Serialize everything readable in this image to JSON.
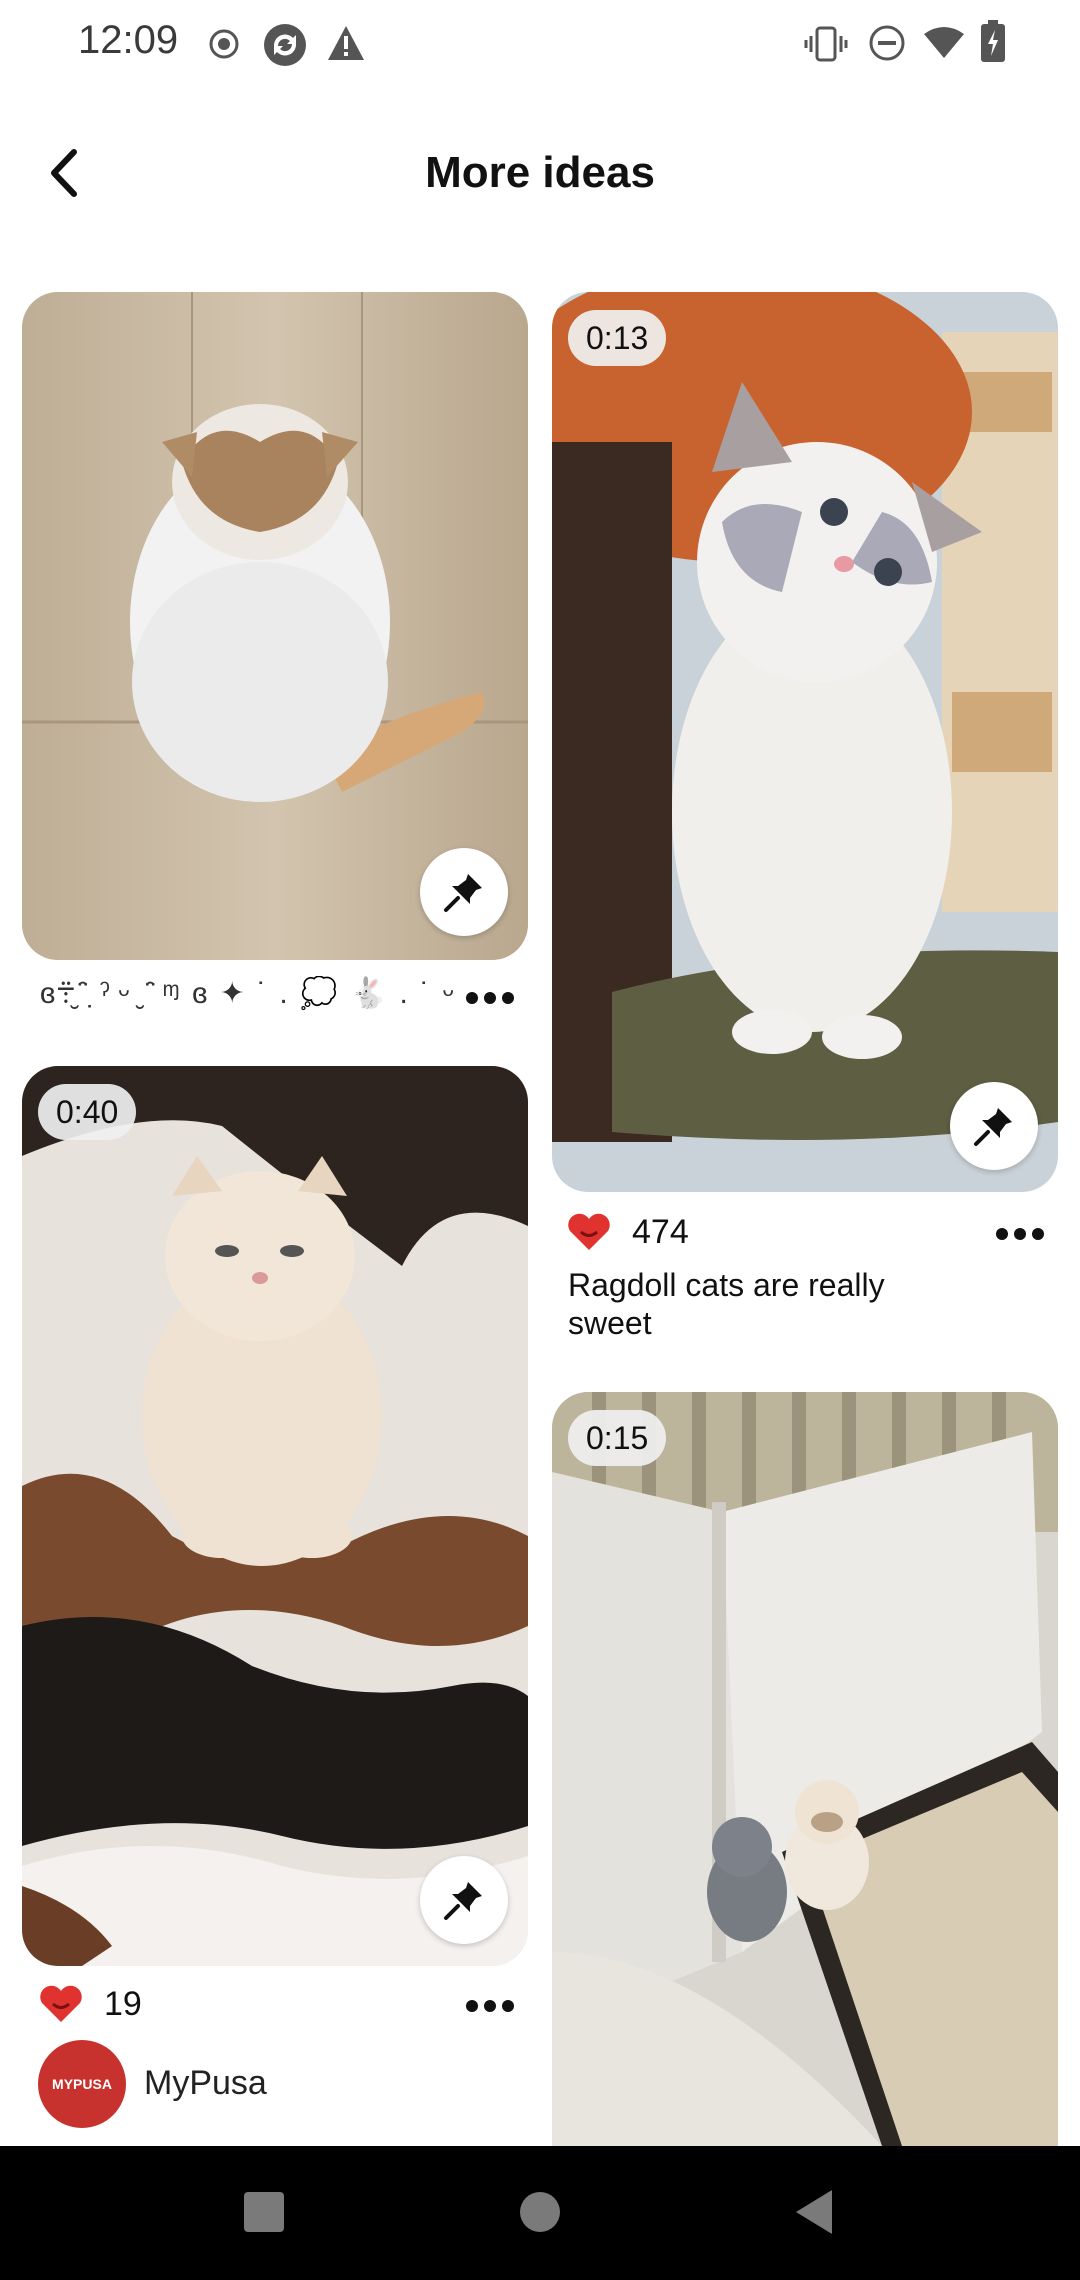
{
  "status_bar": {
    "time": "12:09",
    "left_icons": [
      "record-icon",
      "sync-icon",
      "warning-icon"
    ],
    "right_icons": [
      "vibrate-icon",
      "dnd-icon",
      "wifi-icon",
      "battery-icon"
    ]
  },
  "header": {
    "title": "More ideas",
    "back_icon": "chevron-left-icon"
  },
  "pins": [
    {
      "id": "pin-1",
      "badge": "",
      "description": "ɞ܊ ̮ ̑̈ ˀ̣ ᵕ ̮ ̑̈ ᶬ ɞ ✦ ˙ . 💭 🐇 . ˙ ᵕ",
      "photo": "cat-from-above"
    },
    {
      "id": "pin-2",
      "badge": "0:13",
      "likes": "474",
      "title": "Ragdoll cats are really sweet",
      "photo": "ragdoll-cat"
    },
    {
      "id": "pin-3",
      "badge": "0:40",
      "likes": "19",
      "author": "MyPusa",
      "avatar_text": "MYPUSA",
      "photo": "persian-kitten"
    },
    {
      "id": "pin-4",
      "badge": "0:15",
      "photo": "kittens-litter"
    }
  ],
  "colors": {
    "heart": "#e0322f",
    "avatar": "#c8322e",
    "navbar": "#000000"
  },
  "navbar": {
    "icons": [
      "recents-square-icon",
      "home-circle-icon",
      "back-triangle-icon"
    ]
  }
}
